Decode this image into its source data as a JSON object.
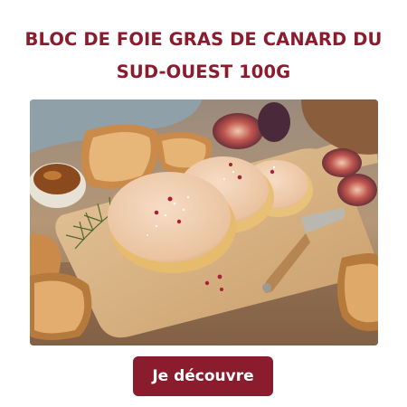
{
  "product": {
    "title_line1": "BLOC DE FOIE GRAS DE CANARD DU",
    "title_line2": "SUD-OUEST 100G",
    "image": "foie-gras-on-board-photo"
  },
  "cta": {
    "label": "Je découvre"
  },
  "colors": {
    "brand": "#8b1c2e",
    "background": "#ffffff",
    "button_text": "#ffffff"
  }
}
